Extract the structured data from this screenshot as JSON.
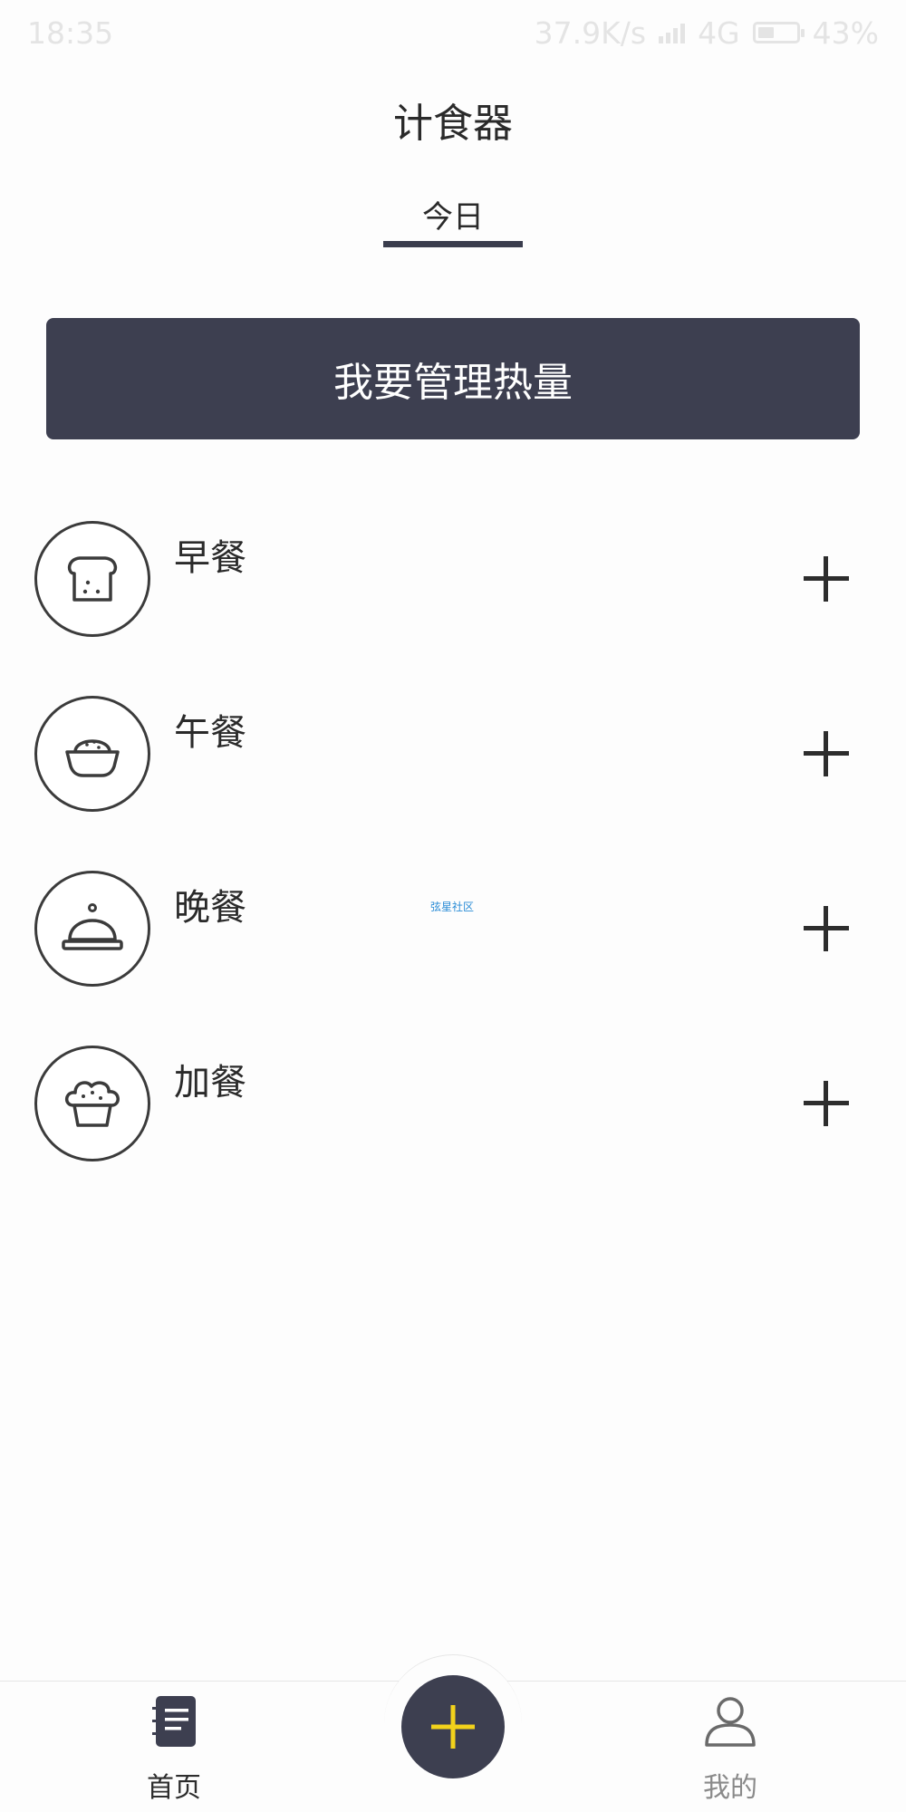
{
  "status_bar": {
    "time": "18:35",
    "network_speed": "37.9K/s",
    "network_type": "4G",
    "battery_percent": "43%",
    "battery_level": 0.43
  },
  "header": {
    "title": "计食器",
    "active_tab": "今日"
  },
  "banner": {
    "label": "我要管理热量"
  },
  "meals": [
    {
      "label": "早餐",
      "icon": "toast-icon"
    },
    {
      "label": "午餐",
      "icon": "rice-bowl-icon"
    },
    {
      "label": "晚餐",
      "icon": "cloche-icon"
    },
    {
      "label": "加餐",
      "icon": "muffin-icon"
    }
  ],
  "add_icon": "plus-icon",
  "watermark": "弦星社区",
  "bottom_nav": {
    "home_label": "首页",
    "me_label": "我的",
    "fab_icon": "plus-icon"
  },
  "colors": {
    "primary_dark": "#3d3f50",
    "fab_plus": "#f2d21b",
    "text": "#2a2a2a",
    "inactive": "#8a8a8a"
  }
}
